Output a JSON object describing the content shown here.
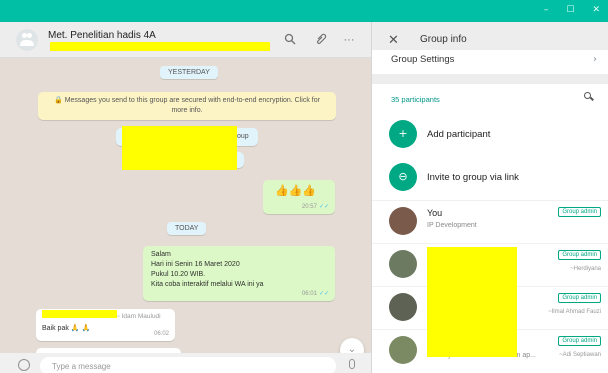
{
  "window": {
    "controls": [
      "–",
      "☐",
      "✕"
    ]
  },
  "chat": {
    "title": "Met. Penelitian hadis 4A",
    "date_yesterday": "YESTERDAY",
    "encryption_notice": "🔒 Messages you send to this group are secured with end-to-end encryption. Click for more info.",
    "system_fragment": "oup",
    "thumbs_message": "👍👍👍",
    "thumbs_time": "20:57",
    "date_today": "TODAY",
    "announcement_lines": [
      "Salam",
      "Hari ini Senin 16 Maret 2020",
      "Pukul 10.20 WIB.",
      "Kita coba interaktif melalui WA ini ya"
    ],
    "announcement_time": "06:01",
    "reply_sender_fragment": "~ Idam Mauludi",
    "reply_text": "Baik pak 🙏 🙏",
    "reply_time": "06:02",
    "composer_placeholder": "Type a message"
  },
  "info": {
    "title": "Group info",
    "group_settings": "Group Settings",
    "participant_count": "35 participants",
    "add_participant": "Add participant",
    "invite_link": "Invite to group via link",
    "members": [
      {
        "name": "You",
        "status": "IP Development",
        "badge": "Group admin",
        "pushname": ""
      },
      {
        "name": "",
        "status": "",
        "badge": "Group admin",
        "pushname": "~Herdiyana"
      },
      {
        "name": "",
        "status": "",
        "badge": "Group admin",
        "pushname": "~Ilmal Ahmad Fauzi"
      },
      {
        "name": "",
        "status": "Tersenyumlah dalam keadaan ap...",
        "badge": "Group admin",
        "pushname": "~Adi Septiawan"
      }
    ]
  }
}
